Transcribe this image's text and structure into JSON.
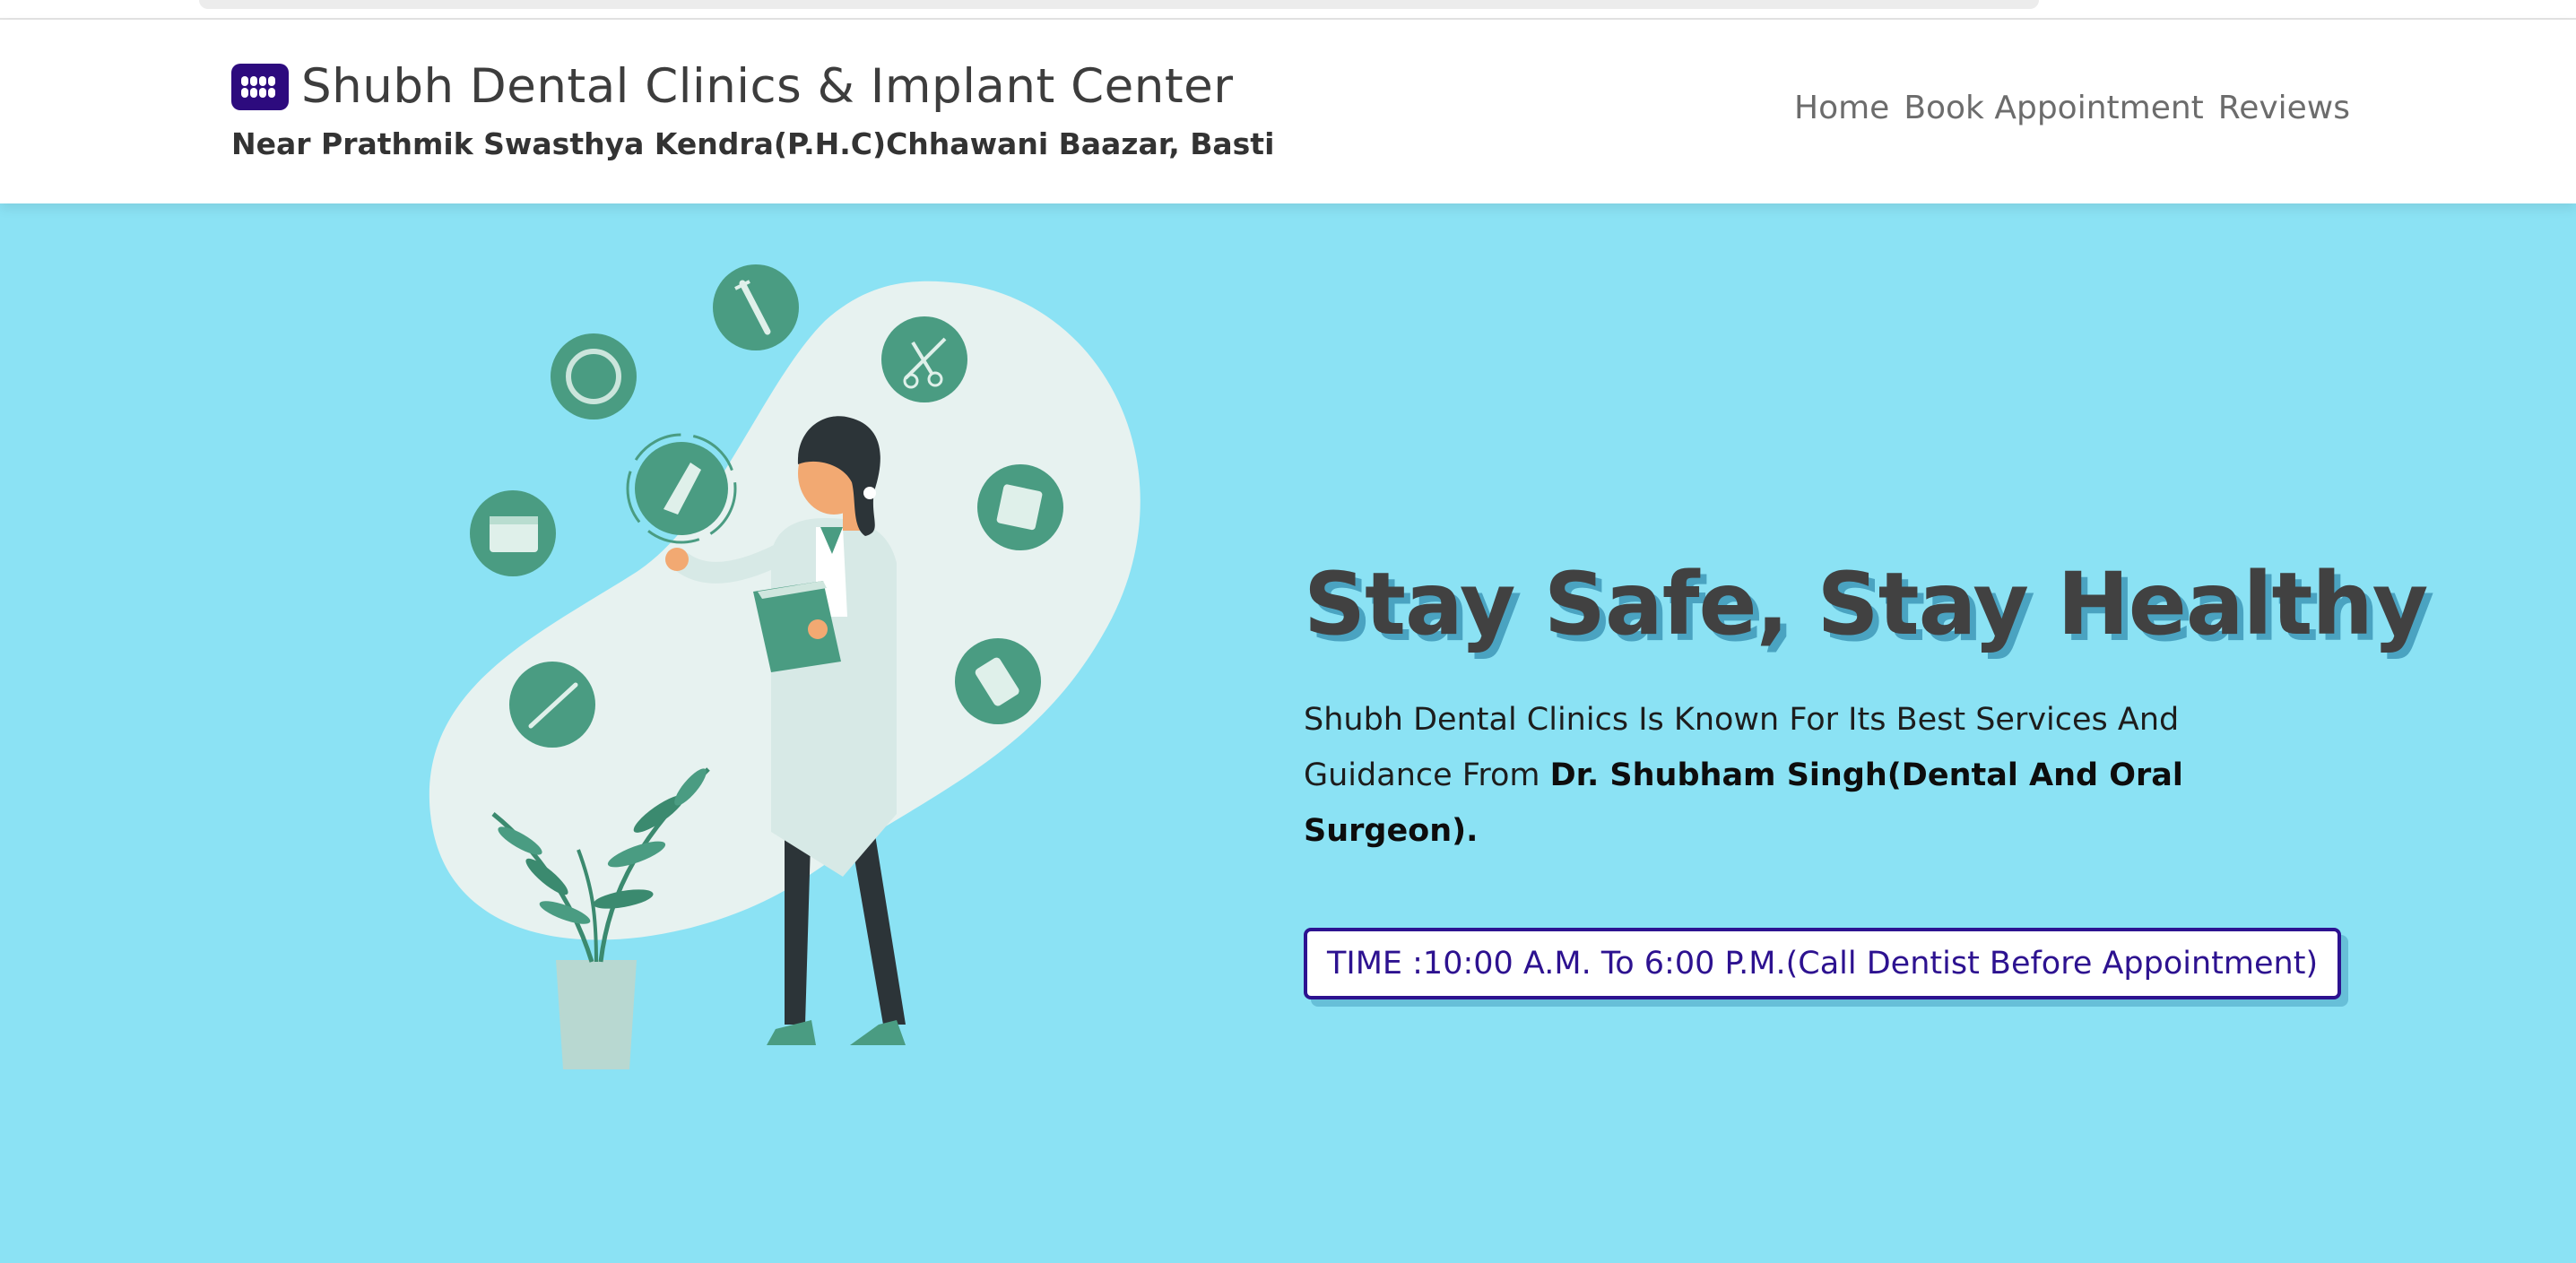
{
  "header": {
    "brand_title": "Shubh Dental Clinics & Implant Center",
    "address": "Near Prathmik Swasthya Kendra(P.H.C)Chhawani Baazar, Basti",
    "logo_icon": "teeth-icon",
    "nav": [
      {
        "label": "Home"
      },
      {
        "label": "Book Appointment"
      },
      {
        "label": "Reviews"
      }
    ]
  },
  "hero": {
    "headline": "Stay Safe, Stay Healthy",
    "desc_prefix": "Shubh Dental Clinics Is Known For Its Best Services And Guidance From ",
    "desc_bold": "Dr. Shubham Singh(Dental And Oral Surgeon).",
    "timing": "TIME :10:00 A.M. To 6:00 P.M.(Call Dentist Before Appointment)",
    "illustration": "doctor-with-medical-icons-illustration"
  },
  "colors": {
    "hero_background": "#8be2f4",
    "brand_accent": "#2d0b7e",
    "icon_green": "#4a9c82",
    "headline_shadow": "#4aa3c1"
  }
}
